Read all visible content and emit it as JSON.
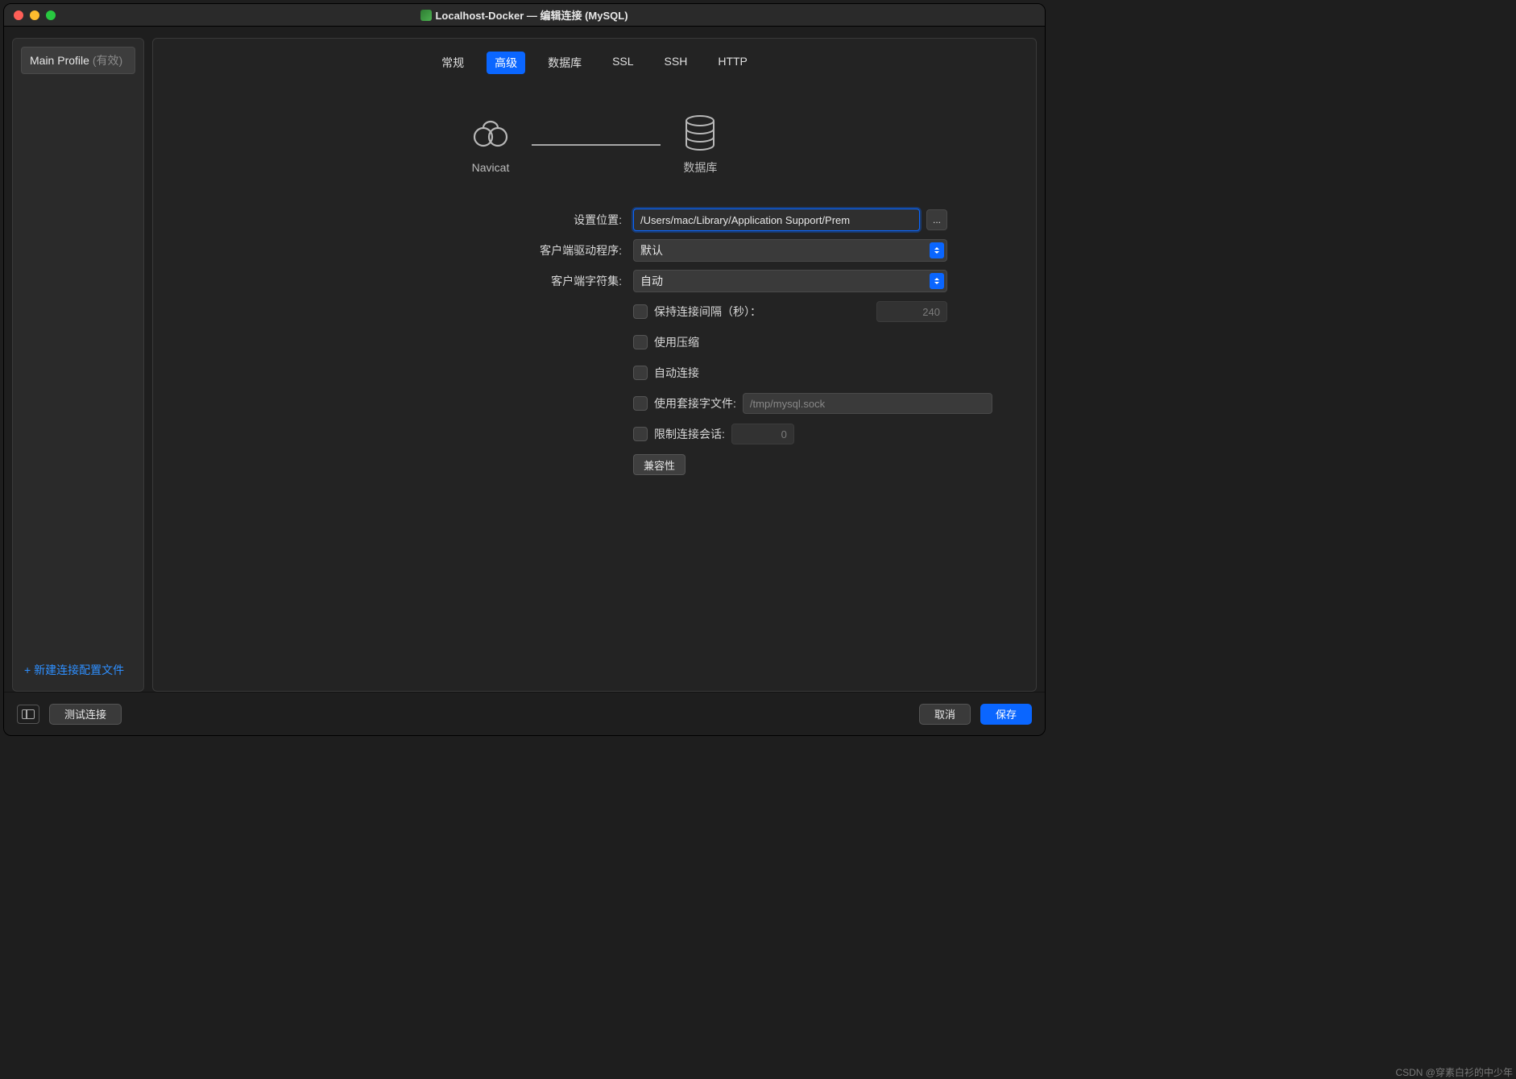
{
  "titlebar": {
    "title": "Localhost-Docker — 编辑连接 (MySQL)"
  },
  "sidebar": {
    "profile_name": "Main Profile",
    "profile_status": "(有效)",
    "new_profile": "+ 新建连接配置文件"
  },
  "tabs": {
    "items": [
      "常规",
      "高级",
      "数据库",
      "SSL",
      "SSH",
      "HTTP"
    ],
    "active": 1
  },
  "graphic": {
    "left_label": "Navicat",
    "right_label": "数据库"
  },
  "form": {
    "settings_location": {
      "label": "设置位置:",
      "value": "/Users/mac/Library/Application Support/Prem",
      "browse": "..."
    },
    "client_driver": {
      "label": "客户端驱动程序:",
      "value": "默认"
    },
    "client_charset": {
      "label": "客户端字符集:",
      "value": "自动"
    },
    "keepalive": {
      "label": "保持连接间隔（秒）：",
      "value": "240"
    },
    "compression": {
      "label": "使用压缩"
    },
    "autoconnect": {
      "label": "自动连接"
    },
    "socket": {
      "label": "使用套接字文件:",
      "placeholder": "/tmp/mysql.sock"
    },
    "limit_sessions": {
      "label": "限制连接会话:",
      "value": "0"
    },
    "compat": {
      "label": "兼容性"
    }
  },
  "footer": {
    "test": "测试连接",
    "cancel": "取消",
    "save": "保存"
  },
  "watermark": "CSDN @穿素白衫的中少年"
}
